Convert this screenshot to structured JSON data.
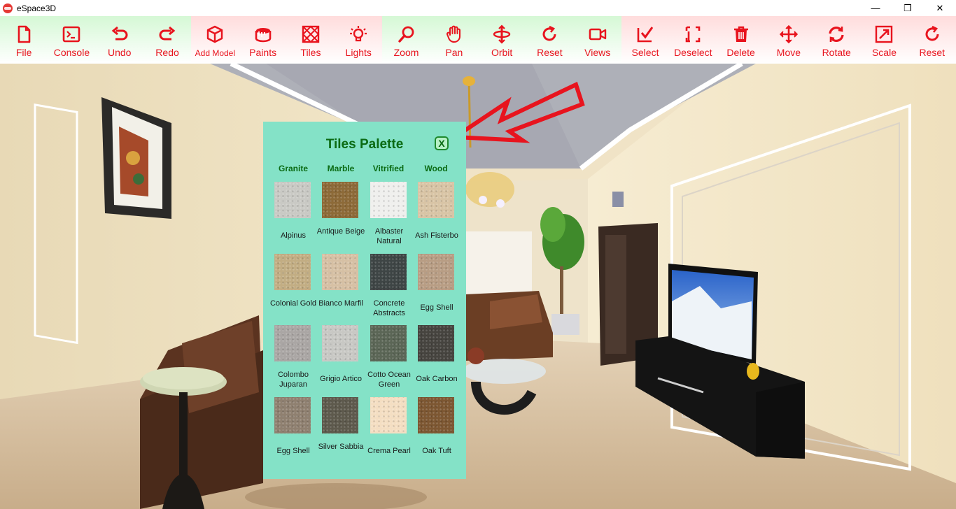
{
  "app": {
    "title": "eSpace3D",
    "window_controls": [
      "—",
      "❐",
      "✕"
    ]
  },
  "toolbar": {
    "groups": [
      {
        "color": "green",
        "tools": [
          {
            "label": "File",
            "icon": "file-icon"
          },
          {
            "label": "Console",
            "icon": "console-icon"
          },
          {
            "label": "Undo",
            "icon": "undo-icon"
          },
          {
            "label": "Redo",
            "icon": "redo-icon"
          }
        ]
      },
      {
        "color": "pink",
        "tools": [
          {
            "label": "Add Model",
            "icon": "cube-icon"
          },
          {
            "label": "Paints",
            "icon": "paint-bucket-icon"
          },
          {
            "label": "Tiles",
            "icon": "tiles-icon"
          },
          {
            "label": "Lights",
            "icon": "bulb-icon"
          }
        ]
      },
      {
        "color": "green",
        "tools": [
          {
            "label": "Zoom",
            "icon": "magnifier-icon"
          },
          {
            "label": "Pan",
            "icon": "hand-icon"
          },
          {
            "label": "Orbit",
            "icon": "orbit-icon"
          },
          {
            "label": "Reset",
            "icon": "reset-icon"
          },
          {
            "label": "Views",
            "icon": "camera-icon"
          }
        ]
      },
      {
        "color": "pink",
        "tools": [
          {
            "label": "Select",
            "icon": "select-icon"
          },
          {
            "label": "Deselect",
            "icon": "deselect-icon"
          },
          {
            "label": "Delete",
            "icon": "trash-icon"
          },
          {
            "label": "Move",
            "icon": "move-arrows-icon"
          },
          {
            "label": "Rotate",
            "icon": "rotate-icon"
          },
          {
            "label": "Scale",
            "icon": "scale-icon"
          },
          {
            "label": "Reset",
            "icon": "reset-icon"
          }
        ]
      }
    ],
    "colors": {
      "label": "#e8141e",
      "green_bg": "#d5f8d5",
      "pink_bg": "#ffdcdc"
    }
  },
  "palette": {
    "title": "Tiles Palette",
    "close_label": "X",
    "columns": [
      "Granite",
      "Marble",
      "Vitrified",
      "Wood"
    ],
    "tiles": [
      [
        {
          "name": "Alpinus",
          "color": "#c9c9c4"
        },
        {
          "name": "Antique Beige",
          "color": "#8d6a38"
        },
        {
          "name": "Albaster Natural",
          "color": "#efefed"
        },
        {
          "name": "Ash Fisterbo",
          "color": "#d8c4a5"
        }
      ],
      [
        {
          "name": "Colonial Gold",
          "color": "#c2ad83"
        },
        {
          "name": "Bianco Marfil",
          "color": "#d6c0a4"
        },
        {
          "name": "Concrete Abstracts",
          "color": "#3e4545"
        },
        {
          "name": "Egg Shell",
          "color": "#b89d84"
        }
      ],
      [
        {
          "name": "Colombo Juparan",
          "color": "#aaa6a4"
        },
        {
          "name": "Grigio Artico",
          "color": "#c8c8c4"
        },
        {
          "name": "Cotto Ocean Green",
          "color": "#5b6656"
        },
        {
          "name": "Oak Carbon",
          "color": "#46443f"
        }
      ],
      [
        {
          "name": "Egg Shell",
          "color": "#8f8070"
        },
        {
          "name": "Silver Sabbia",
          "color": "#5e5a4d"
        },
        {
          "name": "Crema Pearl",
          "color": "#f4dec2"
        },
        {
          "name": "Oak Tuft",
          "color": "#7d5732"
        }
      ]
    ],
    "colors": {
      "background": "#84e2c7",
      "heading": "#0b6b14"
    }
  },
  "annotation": {
    "arrow_color": "#e8141e"
  }
}
